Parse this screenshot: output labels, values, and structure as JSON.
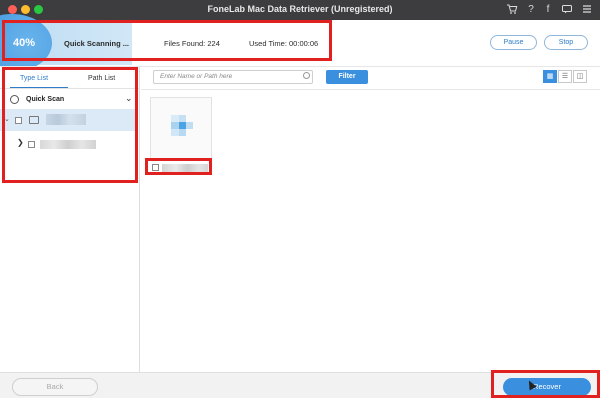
{
  "window": {
    "title": "FoneLab Mac Data Retriever (Unregistered)",
    "toolbar_icons": [
      "cart-icon",
      "help-icon",
      "facebook-icon",
      "chat-icon",
      "menu-icon"
    ]
  },
  "scan": {
    "percent_label": "40%",
    "progress_fraction": 0.4,
    "status": "Quick Scanning ...",
    "files_found": "Files Found: 224",
    "used_time": "Used Time: 00:00:06",
    "pause_label": "Pause",
    "stop_label": "Stop"
  },
  "sidebar": {
    "tabs": [
      {
        "label": "Type List",
        "active": true
      },
      {
        "label": "Path List",
        "active": false
      }
    ],
    "quick_scan_label": "Quick Scan"
  },
  "content": {
    "search_placeholder": "Enter Name or Path here",
    "filter_label": "Filter",
    "view_modes": [
      "grid-view-icon",
      "list-view-icon",
      "detail-view-icon"
    ],
    "active_view": "grid-view-icon"
  },
  "footer": {
    "back_label": "Back",
    "recover_label": "Recover"
  },
  "colors": {
    "accent": "#3a8fde",
    "highlight": "#e0211f",
    "titlebar": "#3d3d3f"
  }
}
